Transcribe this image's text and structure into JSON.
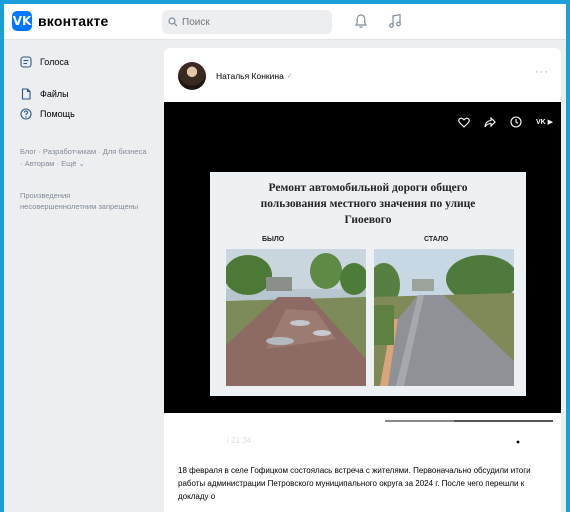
{
  "header": {
    "logo_letter": "VK",
    "logo_text": "вконтакте",
    "search_placeholder": "Поиск",
    "icons": [
      "search-icon",
      "bell-icon",
      "music-icon"
    ]
  },
  "sidebar": {
    "items": [
      {
        "label": "Голоса",
        "icon": "poll-icon"
      },
      {
        "label": "Файлы",
        "icon": "file-icon"
      },
      {
        "label": "Помощь",
        "icon": "help-icon"
      }
    ],
    "links_text": "Блог · Разработчикам · Для бизнеса · Авторам · Ещё ⌄",
    "note_text": "Произведения несовершеннолетним запрещены"
  },
  "post": {
    "author": "Наталья Конкина",
    "verified_mark": "✓",
    "more_label": "···",
    "video": {
      "top_icons": [
        "heart-icon",
        "share-icon",
        "clock-icon",
        "vk-video-icon"
      ],
      "watermark": "VK ▶",
      "slide_title": "Ремонт автомобильной дороги общего пользования местного значения по улице Гиоевого",
      "before_label": "БЫЛО",
      "after_label": "СТАЛО",
      "current_time": "12:00",
      "duration": "/ 21:34",
      "progress": 0.56,
      "buffered": 0.74
    },
    "text": "18 февраля в селе Гофицком состоялась встреча с жителями. Первоначально обсудили итоги работы администрации Петровского муниципального округа за 2024 г. После чего перешли к докладу о"
  },
  "colors": {
    "brand": "#0077ff",
    "frame_border": "#1a9fd8",
    "page_bg": "#edeef0",
    "muted": "#818c99"
  }
}
